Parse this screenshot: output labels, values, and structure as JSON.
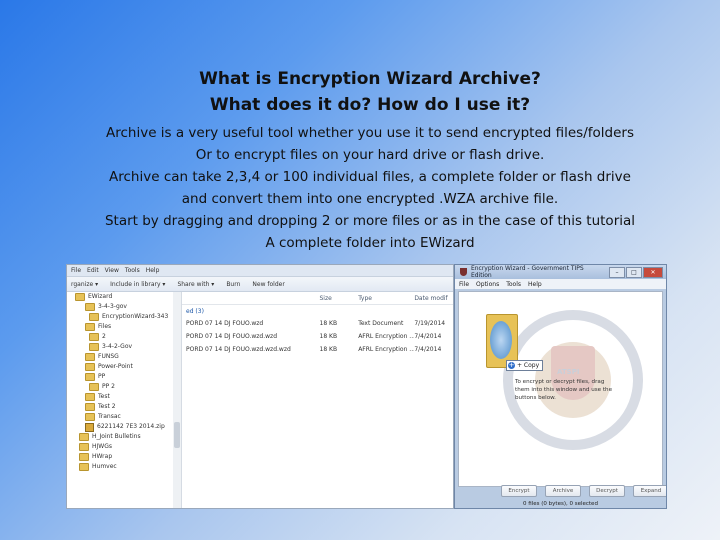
{
  "slide": {
    "title_lines": [
      "What is Encryption Wizard Archive?",
      "What does it do? How do I use it?"
    ],
    "body_lines": [
      "Archive is a very useful tool whether you use it to send encrypted files/folders",
      "Or to encrypt files on your hard drive or flash drive.",
      "Archive can take 2,3,4 or 100 individual files,  a complete folder or  flash drive",
      "and convert them into one encrypted .WZA archive file.",
      "Start by dragging and dropping 2 or more files or as in the case of this tutorial",
      "A complete folder into EWizard"
    ]
  },
  "explorer": {
    "menu": [
      "File",
      "Edit",
      "View",
      "Tools",
      "Help"
    ],
    "toolbar": [
      "rganize ▾",
      "Include in library ▾",
      "Share with ▾",
      "Burn",
      "New folder"
    ],
    "nav_items": [
      {
        "label": "EWizard",
        "icon": "folder-icon"
      },
      {
        "label": "3-4-3-gov",
        "icon": "folder-icon"
      },
      {
        "label": "EncryptionWizard-343",
        "icon": "folder-icon"
      },
      {
        "label": "Files",
        "icon": "folder-icon"
      },
      {
        "label": "2",
        "icon": "folder-icon"
      },
      {
        "label": "3-4-2-Gov",
        "icon": "folder-icon"
      },
      {
        "label": "FUNSG",
        "icon": "folder-icon"
      },
      {
        "label": "Power-Point",
        "icon": "folder-icon"
      },
      {
        "label": "PP",
        "icon": "folder-icon"
      },
      {
        "label": "PP 2",
        "icon": "folder-icon"
      },
      {
        "label": "Test",
        "icon": "folder-icon"
      },
      {
        "label": "Test 2",
        "icon": "folder-icon"
      },
      {
        "label": "Transac",
        "icon": "folder-icon"
      },
      {
        "label": "6221142 7E3 2014.zip",
        "icon": "zip-icon"
      },
      {
        "label": "H_Joint Bulletins",
        "icon": "folder-icon"
      },
      {
        "label": "HJWGs",
        "icon": "folder-icon"
      },
      {
        "label": "HWrap",
        "icon": "folder-icon"
      },
      {
        "label": "Humvec",
        "icon": "folder-icon"
      }
    ],
    "columns": {
      "size": "Size",
      "type": "Type",
      "date": "Date modif"
    },
    "group_label": "ed (3)",
    "files": [
      {
        "name": "PORD 07 14 DJ FOUO.wzd",
        "size": "18 KB",
        "type": "Text Document",
        "date": "7/19/2014"
      },
      {
        "name": "PORD 07 14 DJ FOUO.wzd.wzd",
        "size": "18 KB",
        "type": "AFRL Encryption ...",
        "date": "7/4/2014"
      },
      {
        "name": "PORD 07 14 DJ FOUO.wzd.wzd.wzd",
        "size": "18 KB",
        "type": "AFRL Encryption ...",
        "date": "7/4/2014"
      }
    ]
  },
  "wizard": {
    "title": "Encryption Wizard - Government TIPS Edition",
    "menu": [
      "File",
      "Options",
      "Tools",
      "Help"
    ],
    "copy_label": "+ Copy",
    "instruction": "To encrypt or decrypt files, drag them into this window and use the buttons below.",
    "buttons": [
      "Encrypt",
      "Archive",
      "Decrypt",
      "Expand"
    ],
    "status": "0 files (0 bytes), 0 selected"
  }
}
